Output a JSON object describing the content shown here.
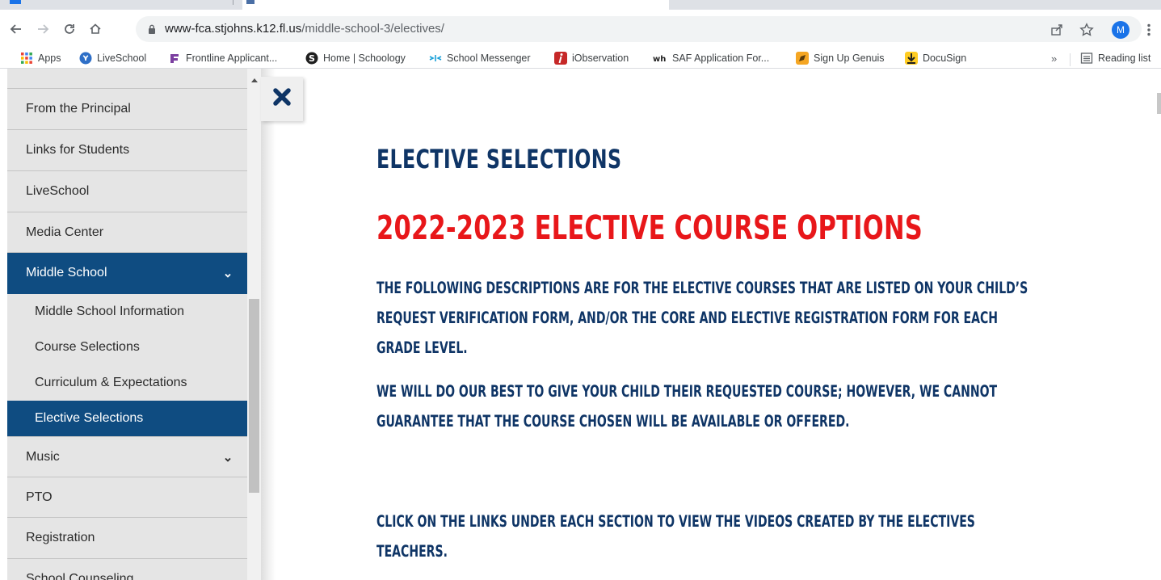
{
  "browser": {
    "url_host": "www-fca.stjohns.k12.fl.us",
    "url_path": "/middle-school-3/electives/",
    "avatar_initial": "M",
    "nav_icons": [
      "back-icon",
      "forward-icon",
      "reload-icon",
      "home-icon"
    ],
    "toolbar_icons": [
      "share-icon",
      "star-icon",
      "kebab-menu-icon"
    ]
  },
  "bookmarks": {
    "items": [
      {
        "label": "Apps",
        "icon": "apps-grid-icon"
      },
      {
        "label": "LiveSchool",
        "icon": "liveschool-icon"
      },
      {
        "label": "Frontline Applicant...",
        "icon": "frontline-icon"
      },
      {
        "label": "Home | Schoology",
        "icon": "schoology-icon"
      },
      {
        "label": "School Messenger",
        "icon": "messenger-icon"
      },
      {
        "label": "iObservation",
        "icon": "iobservation-icon"
      },
      {
        "label": "SAF Application For...",
        "icon": "saf-icon"
      },
      {
        "label": "Sign Up Genuis",
        "icon": "signup-icon"
      },
      {
        "label": "DocuSign",
        "icon": "docusign-icon"
      }
    ],
    "overflow_label": "»",
    "reading_list_label": "Reading list"
  },
  "sidebar": {
    "items": [
      {
        "label": "From the Principal"
      },
      {
        "label": "Links for Students"
      },
      {
        "label": "LiveSchool"
      },
      {
        "label": "Media Center"
      },
      {
        "label": "Middle School"
      },
      {
        "label": "Middle School Information"
      },
      {
        "label": "Course Selections"
      },
      {
        "label": "Curriculum & Expectations"
      },
      {
        "label": "Elective Selections"
      },
      {
        "label": "Music"
      },
      {
        "label": "PTO"
      },
      {
        "label": "Registration"
      },
      {
        "label": "School Counseling"
      }
    ]
  },
  "main": {
    "heading": "ELECTIVE SELECTIONS",
    "subheading": "2022-2023 ELECTIVE COURSE OPTIONS",
    "paragraph_1": "The following descriptions are for the elective courses that are listed on your child’s Request Verification Form, and/or the Core and Elective Registration Form for each grade level.",
    "paragraph_2": "We will do our best to give your child their requested course; however, we cannot guarantee that the course chosen will be available or offered.",
    "paragraph_3": "Click on the links under each section to view the videos created by the Electives teachers."
  },
  "colors": {
    "navy": "#0f3566",
    "red": "#e8171a",
    "sidebar_active": "#0f4c81",
    "sidebar_bg": "#e5e5e5"
  }
}
